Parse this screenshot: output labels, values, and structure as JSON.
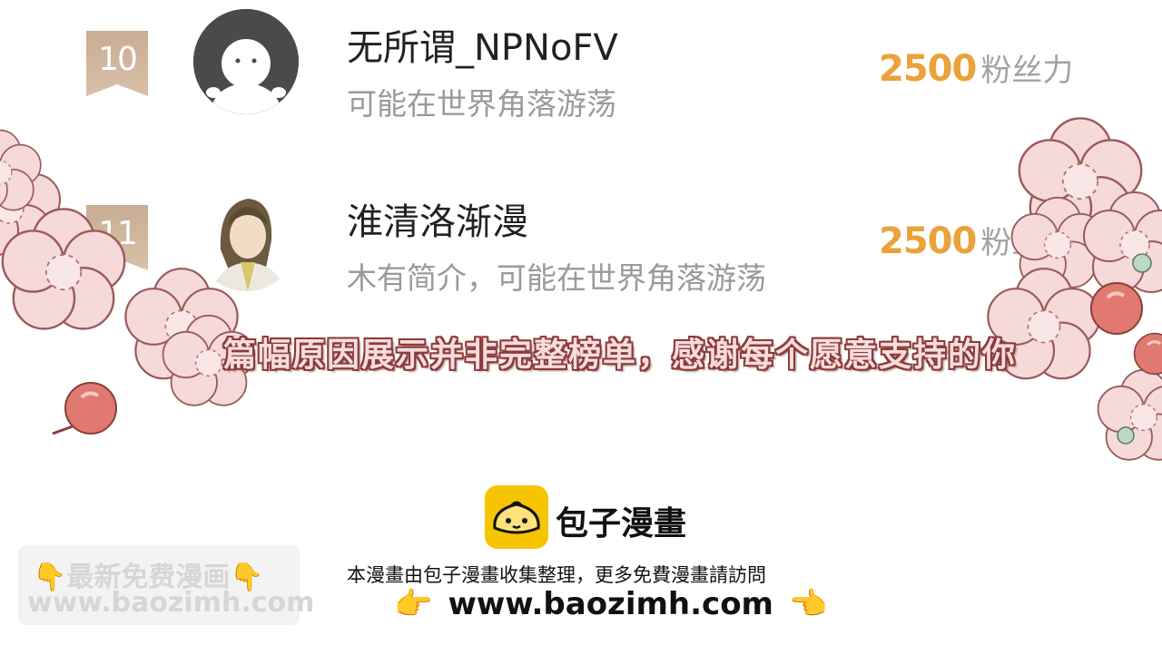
{
  "ranking": [
    {
      "rank": "10",
      "name": "无所谓_NPNoFV",
      "bio": "可能在世界角落游荡",
      "fans_value": "2500",
      "fans_unit": "粉丝力",
      "avatar": "default-avatar-icon"
    },
    {
      "rank": "11",
      "name": "淮清洛渐漫",
      "bio": "木有简介，可能在世界角落游荡",
      "fans_value": "2500",
      "fans_unit": "粉丝力",
      "avatar": "anime-character-avatar"
    }
  ],
  "notice": "篇幅原因展示并非完整榜单，感谢每个愿意支持的你",
  "footer": {
    "brand_name": "包子漫畫",
    "description": "本漫畫由包子漫畫收集整理，更多免費漫畫請訪問",
    "url": "www.baozimh.com",
    "hand_left": "👉",
    "hand_right": "👈"
  },
  "watermark": {
    "line1": "👇最新免费漫画👇",
    "line2": "www.baozimh.com"
  },
  "colors": {
    "rank_badge": "#d0b49a",
    "fan_value": "#eaa23a",
    "blossom": "#f6d9d9",
    "blossom_outline": "#9a5a5a",
    "berry": "#e07a70",
    "logo": "#f6c400"
  }
}
